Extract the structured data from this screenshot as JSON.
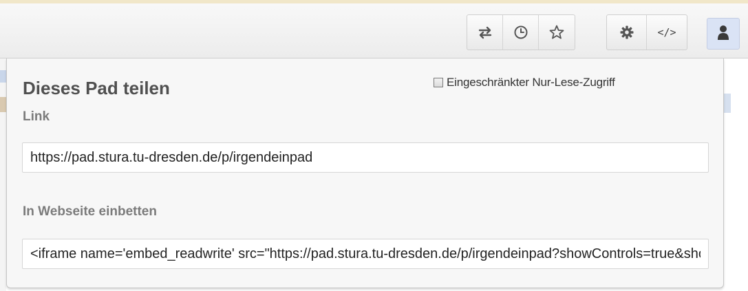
{
  "toolbar": {
    "buttons": [
      {
        "icon": "import-export-icon"
      },
      {
        "icon": "timeslider-icon"
      },
      {
        "icon": "star-icon"
      },
      {
        "icon": "settings-gear-icon"
      },
      {
        "icon": "embed-icon",
        "glyph": "</>"
      },
      {
        "icon": "user-icon"
      }
    ]
  },
  "share_popup": {
    "title": "Dieses Pad teilen",
    "readonly_checkbox": {
      "label": "Eingeschränkter Nur-Lese-Zugriff",
      "checked": false
    },
    "link_label": "Link",
    "link_value": "https://pad.stura.tu-dresden.de/p/irgendeinpad",
    "embed_label": "In Webseite einbetten",
    "embed_value": "<iframe name='embed_readwrite' src=\"https://pad.stura.tu-dresden.de/p/irgendeinpad?showControls=true&showChat=true&showLineNumbers=true&useMonospaceFont=false\" width=600 height=400></iframe>"
  },
  "colors": {
    "accent_user_button": "#dae3f5",
    "label_gray": "#7b7b7b",
    "title_gray": "#505050"
  }
}
